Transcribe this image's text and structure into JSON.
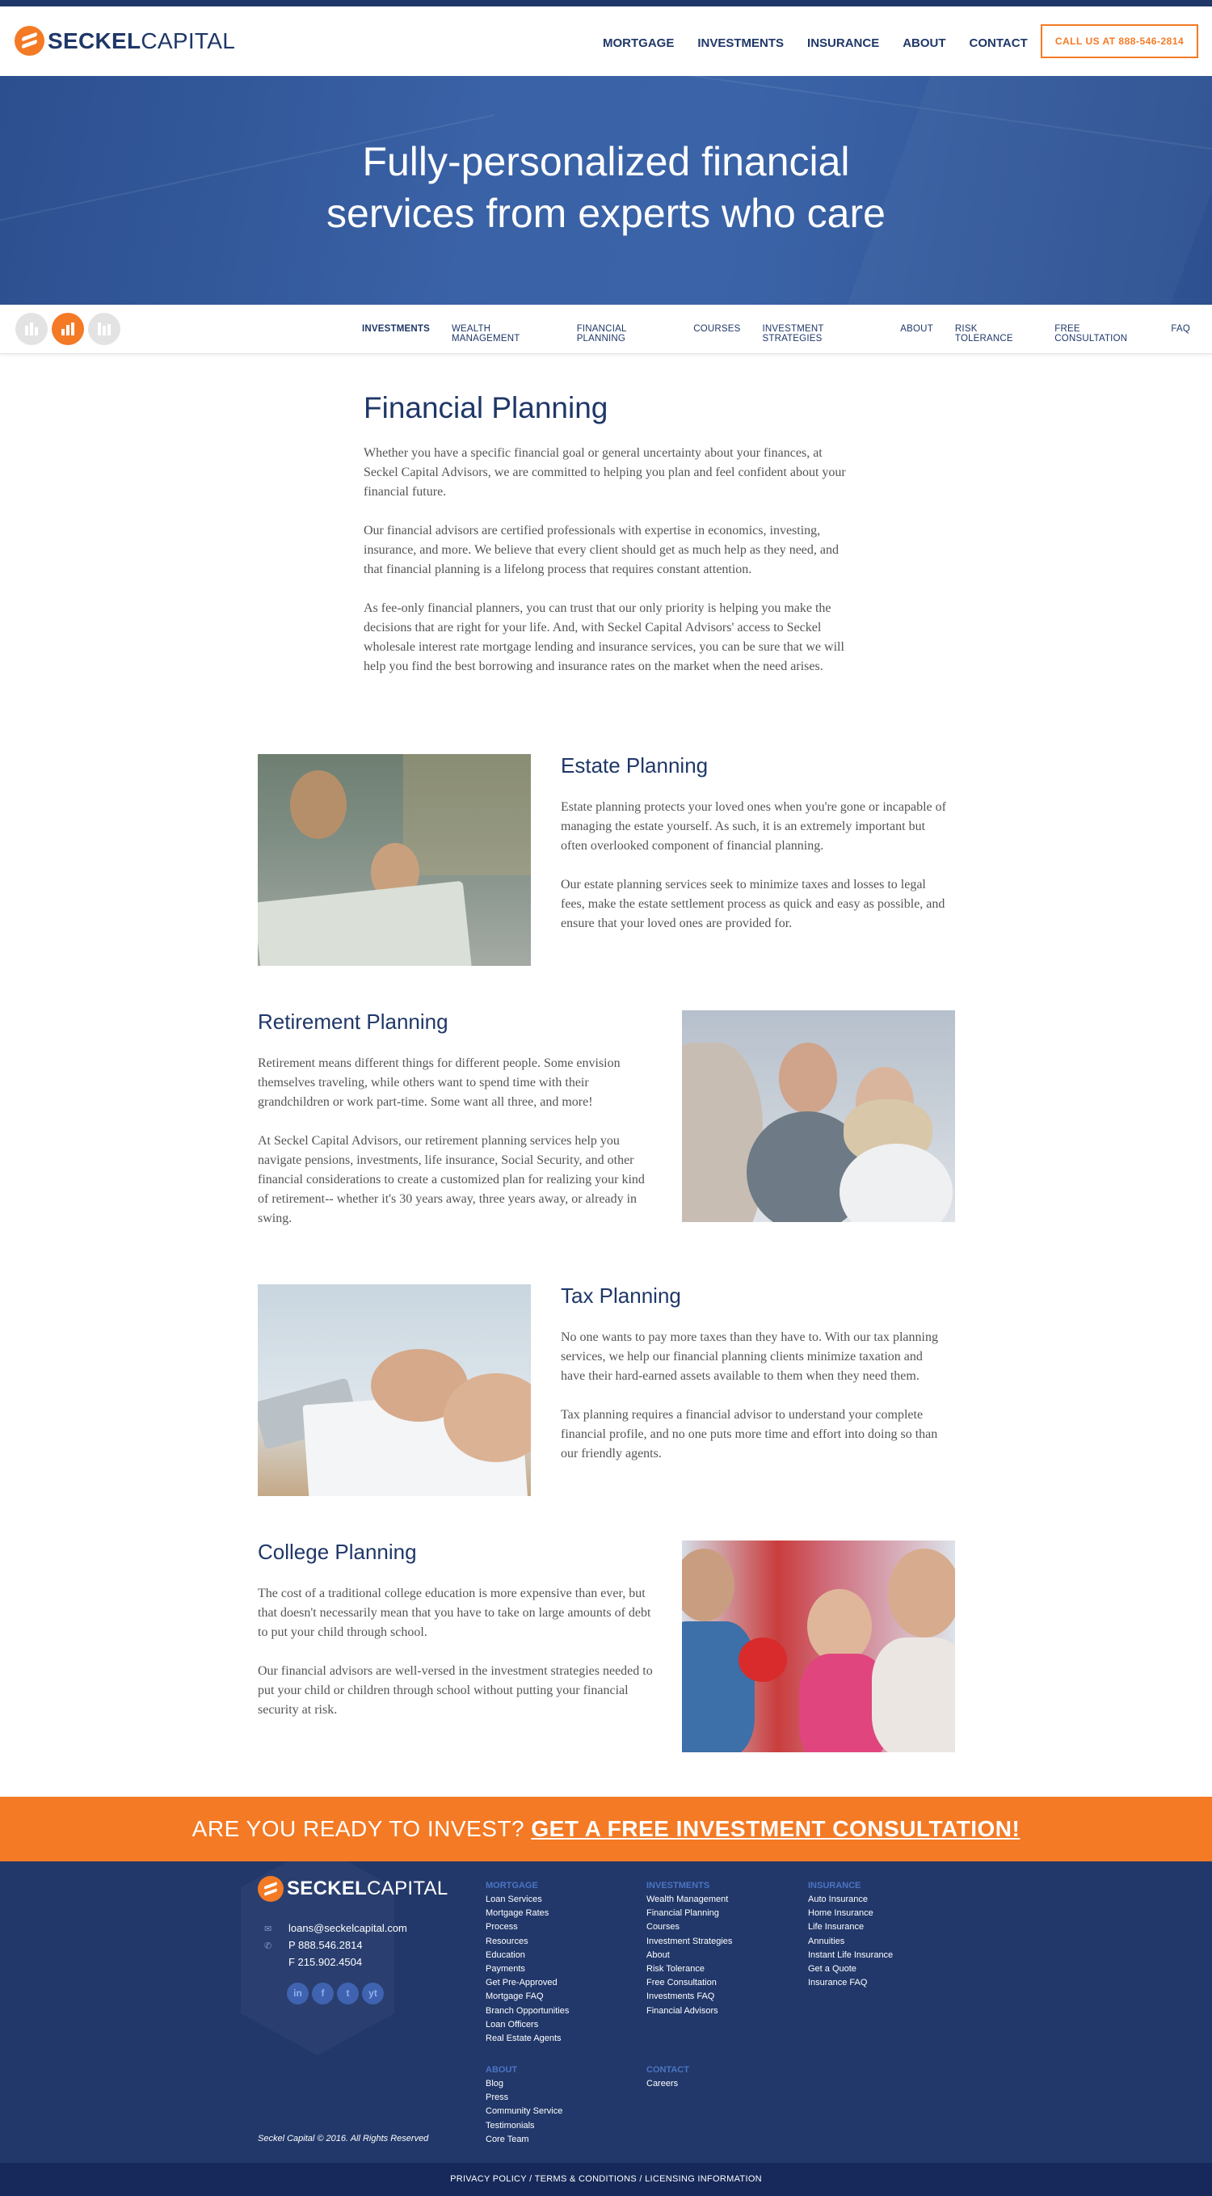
{
  "header": {
    "logo_bold": "SECKEL",
    "logo_light": "CAPITAL",
    "nav": [
      "MORTGAGE",
      "INVESTMENTS",
      "INSURANCE",
      "ABOUT",
      "CONTACT"
    ],
    "call_button": "CALL US AT 888-546-2814"
  },
  "hero": {
    "line1": "Fully-personalized financial",
    "line2": "services from experts who care"
  },
  "subnav": {
    "items": [
      "INVESTMENTS",
      "WEALTH MANAGEMENT",
      "FINANCIAL PLANNING",
      "COURSES",
      "INVESTMENT STRATEGIES",
      "ABOUT",
      "RISK TOLERANCE",
      "FREE CONSULTATION",
      "FAQ"
    ]
  },
  "intro": {
    "title": "Financial Planning",
    "p1": "Whether you have a specific financial goal or general uncertainty about your finances, at Seckel Capital Advisors, we are committed to helping you plan and feel confident about your financial future.",
    "p2": "Our financial advisors are certified professionals with expertise in economics, investing, insurance, and more. We believe that every client should get as much help as they need, and that financial planning is a lifelong process that requires constant attention.",
    "p3": "As fee-only financial planners, you can trust that our only priority is helping you make the decisions that are right for your life. And, with Seckel Capital Advisors' access to Seckel wholesale interest rate mortgage lending and insurance services, you can be sure that we will help you find the best borrowing and insurance rates on the market when the need arises."
  },
  "estate": {
    "title": "Estate Planning",
    "p1": "Estate planning protects your loved ones when you're gone or incapable of managing the estate yourself. As such, it is an extremely important but often overlooked component of financial planning.",
    "p2": "Our estate planning services seek to minimize taxes and losses to legal fees, make the estate settlement process as quick and easy as possible, and ensure that your loved ones are provided for."
  },
  "retirement": {
    "title": "Retirement Planning",
    "p1": "Retirement means different things for different people. Some envision themselves traveling, while others want to spend time with their grandchildren or work part-time. Some want all three, and more!",
    "p2": "At Seckel Capital Advisors, our retirement planning services help you navigate pensions, investments, life insurance, Social Security, and other financial considerations to create a customized plan for realizing your kind of retirement-- whether it's 30 years away, three years away, or already in swing."
  },
  "tax": {
    "title": "Tax Planning",
    "p1": "No one wants to pay more taxes than they have to. With our tax planning services, we help our financial planning clients minimize taxation and have their hard-earned assets available to them when they need them.",
    "p2": "Tax planning requires a financial advisor to understand your complete financial profile, and no one puts more time and effort into doing so than our friendly agents."
  },
  "college": {
    "title": "College Planning",
    "p1": "The cost of a traditional college education is more expensive than ever, but that doesn't necessarily mean that you have to take on large amounts of debt to put your child through school.",
    "p2": "Our financial advisors are well-versed in the investment strategies needed to put your child or children through school without putting your financial security at risk."
  },
  "cta": {
    "lead": "ARE YOU READY TO INVEST?",
    "link": "GET A FREE INVESTMENT CONSULTATION!"
  },
  "footer": {
    "email": "loans@seckelcapital.com",
    "phone": "P 888.546.2814",
    "fax": "F 215.902.4504",
    "social": [
      "in",
      "f",
      "t",
      "yt"
    ],
    "mortgage": {
      "heading": "MORTGAGE",
      "links": [
        "Loan Services",
        "Mortgage Rates",
        "Process",
        "Resources",
        "Education",
        "Payments",
        "Get Pre-Approved",
        "Mortgage FAQ",
        "Branch Opportunities",
        "Loan Officers",
        "Real Estate Agents"
      ]
    },
    "investments": {
      "heading": "INVESTMENTS",
      "links": [
        "Wealth Management",
        "Financial Planning",
        "Courses",
        "Investment Strategies",
        "About",
        "Risk Tolerance",
        "Free Consultation",
        "Investments FAQ",
        "Financial Advisors"
      ]
    },
    "insurance": {
      "heading": "INSURANCE",
      "links": [
        "Auto Insurance",
        "Home Insurance",
        "Life Insurance",
        "Annuities",
        "Instant Life Insurance",
        "Get a Quote",
        "Insurance FAQ"
      ]
    },
    "about": {
      "heading": "ABOUT",
      "links": [
        "Blog",
        "Press",
        "Community Service",
        "Testimonials",
        "Core Team"
      ]
    },
    "contact": {
      "heading": "CONTACT",
      "links": [
        "Careers"
      ]
    },
    "copyright": "Seckel Capital © 2016. All Rights Reserved",
    "legal": "PRIVACY POLICY / TERMS & CONDITIONS / LICENSING INFORMATION"
  },
  "colors": {
    "brand_navy": "#1f3768",
    "brand_orange": "#f47a25",
    "hero_blue": "#3a62a6",
    "footer_navy": "#22386a"
  }
}
